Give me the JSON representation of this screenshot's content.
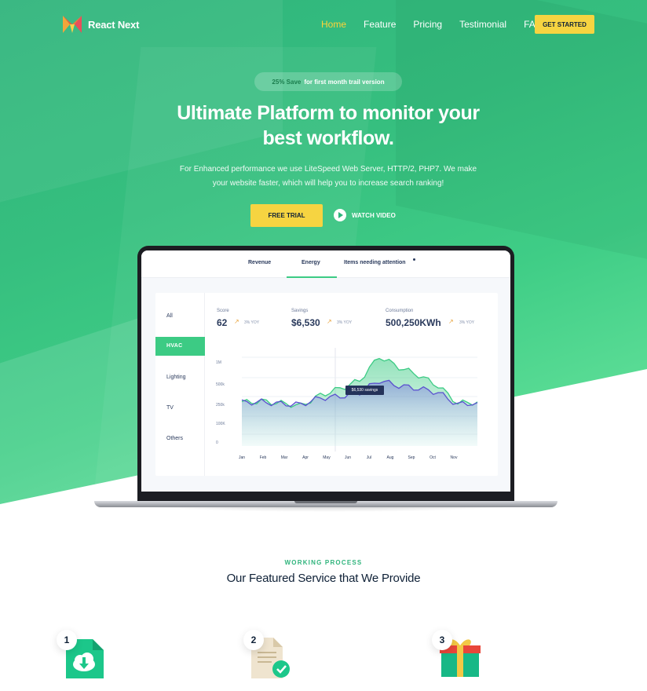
{
  "brand": {
    "name": "React Next"
  },
  "nav": {
    "items": [
      "Home",
      "Feature",
      "Pricing",
      "Testimonial",
      "FAQ"
    ],
    "cta": "GET STARTED"
  },
  "hero": {
    "pill_save": "25% Save",
    "pill_text": "for first month trail version",
    "title_line1": "Ultimate Platform to monitor your",
    "title_line2": "best workflow.",
    "subtitle_line1": "For Enhanced performance we use LiteSpeed Web Server, HTTP/2, PHP7. We make",
    "subtitle_line2": "your website faster, which will help you to increase search ranking!",
    "trial_button": "FREE TRIAL",
    "watch_button": "WATCH VIDEO"
  },
  "dashboard": {
    "tabs": [
      "Revenue",
      "Energy",
      "Items needing attention"
    ],
    "categories": [
      "All",
      "HVAC",
      "Lighting",
      "TV",
      "Others"
    ],
    "stats": [
      {
        "label": "Score",
        "value": "62",
        "yoy": "3% YOY"
      },
      {
        "label": "Savings",
        "value": "$6,530",
        "yoy": "3% YOY"
      },
      {
        "label": "Consumption",
        "value": "500,250KWh",
        "yoy": "3% YOY"
      }
    ],
    "tooltip": "$6,530 savings"
  },
  "chart_data": {
    "type": "area",
    "x": [
      "Jan",
      "Feb",
      "Mar",
      "Apr",
      "May",
      "Jun",
      "Jul",
      "Aug",
      "Sep",
      "Oct",
      "Nov"
    ],
    "y_ticks": [
      "1M",
      "500k",
      "250k",
      "100K",
      "0"
    ],
    "series": [
      {
        "values": [
          255,
          265,
          250,
          230,
          310,
          360,
          420,
          600,
          520,
          460,
          380,
          250,
          260
        ]
      },
      {
        "values": [
          255,
          260,
          245,
          240,
          290,
          300,
          330,
          420,
          380,
          360,
          330,
          240,
          255
        ]
      }
    ],
    "colors": {
      "upper": "#3ccb84",
      "lower": "#5a4fcf"
    }
  },
  "services": {
    "tag": "WORKING PROCESS",
    "title": "Our Featured Service that We Provide",
    "items": [
      {
        "number": "1",
        "icon": "cloud-download-icon"
      },
      {
        "number": "2",
        "icon": "document-check-icon"
      },
      {
        "number": "3",
        "icon": "gift-icon"
      }
    ]
  }
}
